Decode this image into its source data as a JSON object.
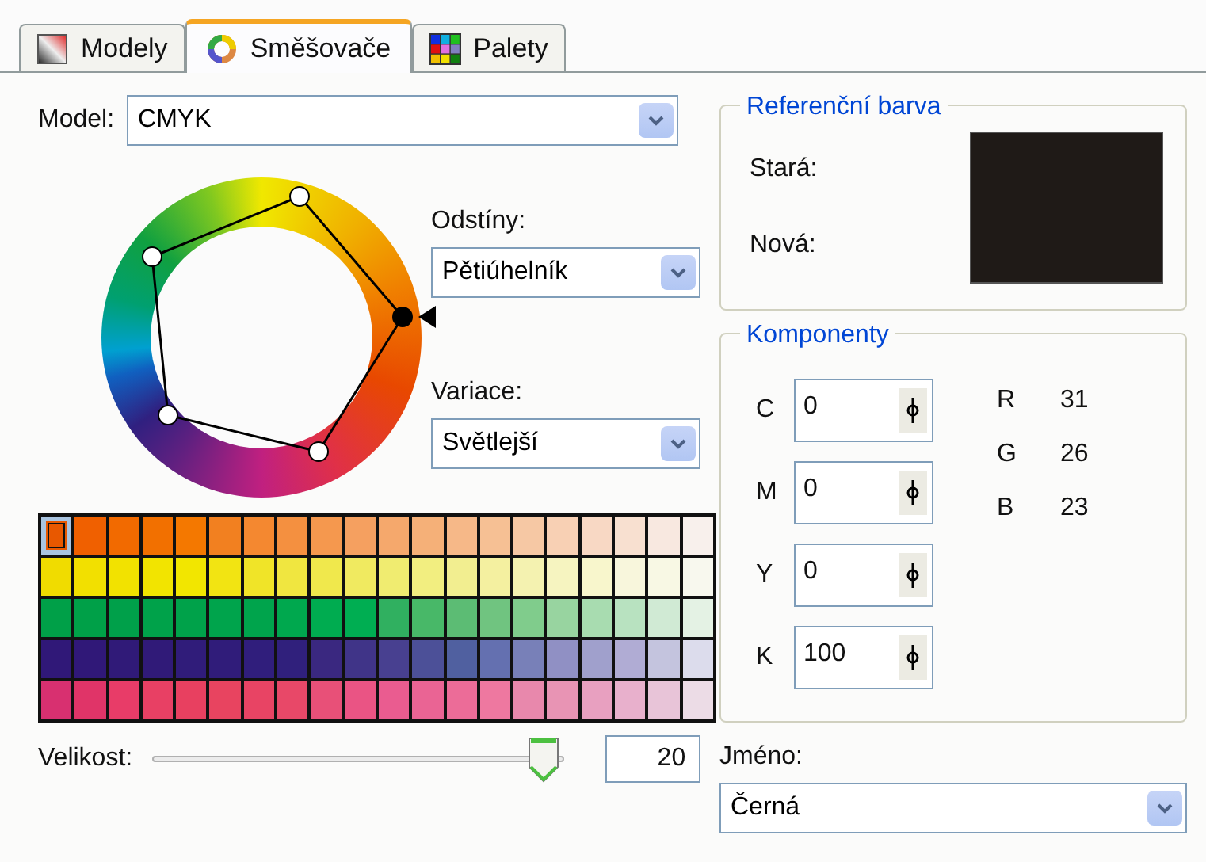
{
  "tabs": [
    {
      "label": "Modely",
      "kind": "models",
      "selected": false
    },
    {
      "label": "Směšovače",
      "kind": "mixers",
      "selected": true
    },
    {
      "label": "Palety",
      "kind": "palettes",
      "selected": false
    }
  ],
  "model": {
    "label": "Model:",
    "value": "CMYK"
  },
  "shades": {
    "label": "Odstíny:",
    "value": "Pětiúhelník"
  },
  "variation": {
    "label": "Variace:",
    "value": "Světlejší"
  },
  "swatch_rows": [
    {
      "cells": [
        {
          "color": "#e85800",
          "selected": true
        },
        {
          "color": "#f06000",
          "selected": false
        },
        {
          "color": "#f26a00",
          "selected": false
        },
        {
          "color": "#f27000",
          "selected": false
        },
        {
          "color": "#f47800",
          "selected": false
        },
        {
          "color": "#f28020",
          "selected": false
        },
        {
          "color": "#f48830",
          "selected": false
        },
        {
          "color": "#f49040",
          "selected": false
        },
        {
          "color": "#f5984e",
          "selected": false
        },
        {
          "color": "#f5a060",
          "selected": false
        },
        {
          "color": "#f5a86c",
          "selected": false
        },
        {
          "color": "#f5b078",
          "selected": false
        },
        {
          "color": "#f6b888",
          "selected": false
        },
        {
          "color": "#f6c094",
          "selected": false
        },
        {
          "color": "#f6c8a4",
          "selected": false
        },
        {
          "color": "#f8d0b4",
          "selected": false
        },
        {
          "color": "#f8d8c4",
          "selected": false
        },
        {
          "color": "#f8e0d0",
          "selected": false
        },
        {
          "color": "#f8e8e0",
          "selected": false
        },
        {
          "color": "#f8f0ec",
          "selected": false
        }
      ]
    },
    {
      "cells": [
        {
          "color": "#f0dc00",
          "selected": false
        },
        {
          "color": "#f2e000",
          "selected": false
        },
        {
          "color": "#f2e200",
          "selected": false
        },
        {
          "color": "#f2e400",
          "selected": false
        },
        {
          "color": "#f2e600",
          "selected": false
        },
        {
          "color": "#f2e412",
          "selected": false
        },
        {
          "color": "#f0e428",
          "selected": false
        },
        {
          "color": "#f0e640",
          "selected": false
        },
        {
          "color": "#f0e84c",
          "selected": false
        },
        {
          "color": "#f0ea60",
          "selected": false
        },
        {
          "color": "#f0ec70",
          "selected": false
        },
        {
          "color": "#f2ee80",
          "selected": false
        },
        {
          "color": "#f2ee90",
          "selected": false
        },
        {
          "color": "#f4f0a0",
          "selected": false
        },
        {
          "color": "#f4f2b0",
          "selected": false
        },
        {
          "color": "#f6f4c0",
          "selected": false
        },
        {
          "color": "#f8f6cc",
          "selected": false
        },
        {
          "color": "#f8f6dc",
          "selected": false
        },
        {
          "color": "#f8f8e4",
          "selected": false
        },
        {
          "color": "#f8f8ee",
          "selected": false
        }
      ]
    },
    {
      "cells": [
        {
          "color": "#00a048",
          "selected": false
        },
        {
          "color": "#00a048",
          "selected": false
        },
        {
          "color": "#00a04a",
          "selected": false
        },
        {
          "color": "#00a24a",
          "selected": false
        },
        {
          "color": "#00a24a",
          "selected": false
        },
        {
          "color": "#00a44c",
          "selected": false
        },
        {
          "color": "#00a44c",
          "selected": false
        },
        {
          "color": "#00a84e",
          "selected": false
        },
        {
          "color": "#00ac50",
          "selected": false
        },
        {
          "color": "#00ae52",
          "selected": false
        },
        {
          "color": "#30b060",
          "selected": false
        },
        {
          "color": "#48b868",
          "selected": false
        },
        {
          "color": "#5cbc74",
          "selected": false
        },
        {
          "color": "#70c480",
          "selected": false
        },
        {
          "color": "#80cc8c",
          "selected": false
        },
        {
          "color": "#98d4a0",
          "selected": false
        },
        {
          "color": "#a8dcb0",
          "selected": false
        },
        {
          "color": "#b8e2c0",
          "selected": false
        },
        {
          "color": "#d0ead4",
          "selected": false
        },
        {
          "color": "#e4f2e4",
          "selected": false
        }
      ]
    },
    {
      "cells": [
        {
          "color": "#301878",
          "selected": false
        },
        {
          "color": "#301878",
          "selected": false
        },
        {
          "color": "#301a78",
          "selected": false
        },
        {
          "color": "#301a78",
          "selected": false
        },
        {
          "color": "#301c7a",
          "selected": false
        },
        {
          "color": "#301c7a",
          "selected": false
        },
        {
          "color": "#301e7c",
          "selected": false
        },
        {
          "color": "#30207c",
          "selected": false
        },
        {
          "color": "#3a2880",
          "selected": false
        },
        {
          "color": "#403488",
          "selected": false
        },
        {
          "color": "#484090",
          "selected": false
        },
        {
          "color": "#4c5098",
          "selected": false
        },
        {
          "color": "#5060a0",
          "selected": false
        },
        {
          "color": "#6470b0",
          "selected": false
        },
        {
          "color": "#7880b8",
          "selected": false
        },
        {
          "color": "#9090c4",
          "selected": false
        },
        {
          "color": "#a0a0cc",
          "selected": false
        },
        {
          "color": "#b0acd4",
          "selected": false
        },
        {
          "color": "#c4c4de",
          "selected": false
        },
        {
          "color": "#dcdcec",
          "selected": false
        }
      ]
    },
    {
      "cells": [
        {
          "color": "#d83070",
          "selected": false
        },
        {
          "color": "#e03468",
          "selected": false
        },
        {
          "color": "#e83c68",
          "selected": false
        },
        {
          "color": "#e84064",
          "selected": false
        },
        {
          "color": "#e84060",
          "selected": false
        },
        {
          "color": "#e84460",
          "selected": false
        },
        {
          "color": "#e84464",
          "selected": false
        },
        {
          "color": "#e84868",
          "selected": false
        },
        {
          "color": "#e85078",
          "selected": false
        },
        {
          "color": "#ea5484",
          "selected": false
        },
        {
          "color": "#ea5c90",
          "selected": false
        },
        {
          "color": "#ea6494",
          "selected": false
        },
        {
          "color": "#ec6c98",
          "selected": false
        },
        {
          "color": "#ee78a0",
          "selected": false
        },
        {
          "color": "#e888ac",
          "selected": false
        },
        {
          "color": "#e894b4",
          "selected": false
        },
        {
          "color": "#e8a0c0",
          "selected": false
        },
        {
          "color": "#e8b0cc",
          "selected": false
        },
        {
          "color": "#e8c4d8",
          "selected": false
        },
        {
          "color": "#ecdce6",
          "selected": false
        }
      ]
    }
  ],
  "size": {
    "label": "Velikost:",
    "level": 0.95,
    "value": "20"
  },
  "reference": {
    "title": "Referenční barva",
    "items": [
      {
        "label": "Stará:",
        "color": "#1f1a17"
      },
      {
        "label": "Nová:",
        "color": "#1f1a17"
      }
    ]
  },
  "components": {
    "title": "Komponenty",
    "cmyk": [
      {
        "label": "C",
        "value": "0"
      },
      {
        "label": "M",
        "value": "0"
      },
      {
        "label": "Y",
        "value": "0"
      },
      {
        "label": "K",
        "value": "100"
      }
    ],
    "rgb": [
      {
        "label": "R",
        "value": "31"
      },
      {
        "label": "G",
        "value": "26"
      },
      {
        "label": "B",
        "value": "23"
      }
    ]
  },
  "name": {
    "label": "Jméno:",
    "value": "Černá"
  }
}
